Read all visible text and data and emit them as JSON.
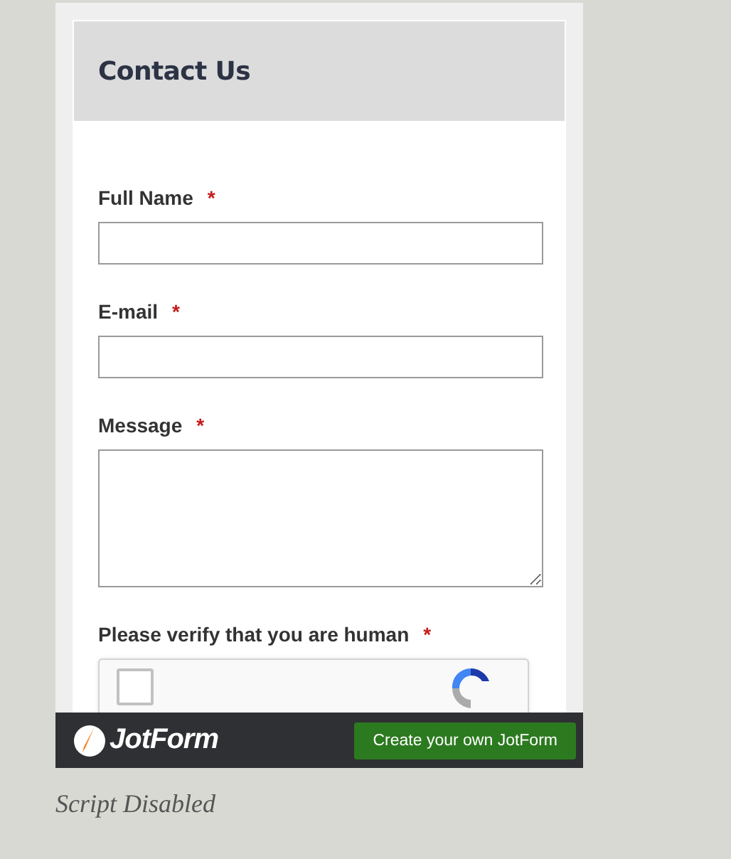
{
  "form": {
    "title": "Contact Us",
    "fields": [
      {
        "kind": "input",
        "label": "Full Name",
        "required": true
      },
      {
        "kind": "input",
        "label": "E-mail",
        "required": true
      },
      {
        "kind": "textarea",
        "label": "Message",
        "required": true
      },
      {
        "kind": "captcha",
        "label": "Please verify that you are human",
        "required": true,
        "checked": false
      }
    ],
    "required_mark": "*"
  },
  "footer": {
    "logo": "JotForm",
    "button": "Create your own JotForm"
  },
  "caption": "Script Disabled"
}
